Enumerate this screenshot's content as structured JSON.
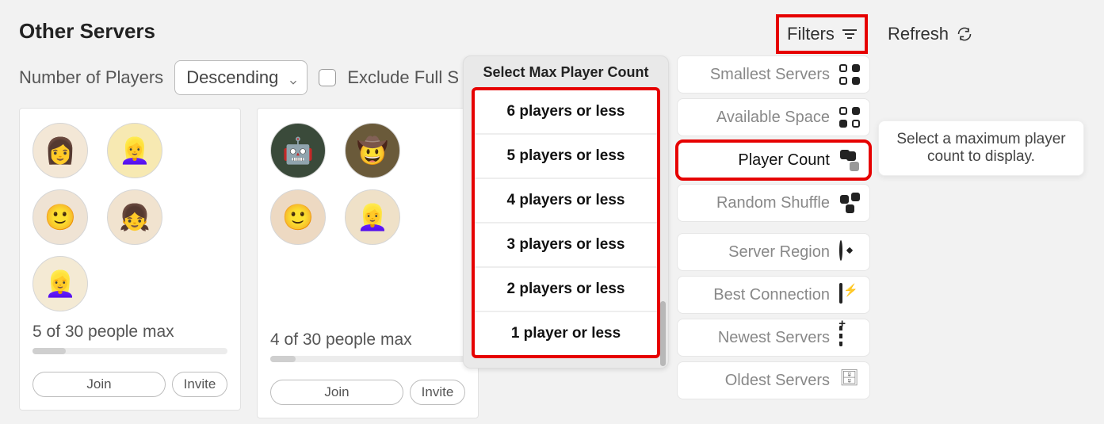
{
  "header": {
    "title": "Other Servers",
    "filters_label": "Filters",
    "refresh_label": "Refresh"
  },
  "controls": {
    "players_label": "Number of Players",
    "sort_value": "Descending",
    "exclude_full_label": "Exclude Full S"
  },
  "servers": [
    {
      "count_text": "5 of 30 people max",
      "progress_pct": 17,
      "join_label": "Join",
      "invite_label": "Invite"
    },
    {
      "count_text": "4 of 30 people max",
      "progress_pct": 13,
      "join_label": "Join",
      "invite_label": "Invite"
    }
  ],
  "avatars1": [
    {
      "bg": "#f3e7d6",
      "emoji": "👩"
    },
    {
      "bg": "#f7e9b2",
      "emoji": "👱‍♀️"
    },
    {
      "bg": "#efe3d4",
      "emoji": "🙂"
    },
    {
      "bg": "#f1e3cf",
      "emoji": "👧"
    },
    {
      "bg": "#f4ead4",
      "emoji": "👱‍♀️"
    }
  ],
  "avatars2": [
    {
      "bg": "#3a4a3a",
      "emoji": "🤖"
    },
    {
      "bg": "#6a5a3a",
      "emoji": "🤠"
    },
    {
      "bg": "#edd9c2",
      "emoji": "🙂"
    },
    {
      "bg": "#efe1c8",
      "emoji": "👱‍♀️"
    }
  ],
  "dropdown": {
    "title": "Select Max Player Count",
    "items": [
      "6 players or less",
      "5 players or less",
      "4 players or less",
      "3 players or less",
      "2 players or less",
      "1 player or less"
    ]
  },
  "filter_menu": {
    "smallest": "Smallest Servers",
    "available": "Available Space",
    "player_count": "Player Count",
    "random": "Random Shuffle",
    "region": "Server Region",
    "best": "Best Connection",
    "newest": "Newest Servers",
    "oldest": "Oldest Servers"
  },
  "tooltip": "Select a maximum player count to display."
}
